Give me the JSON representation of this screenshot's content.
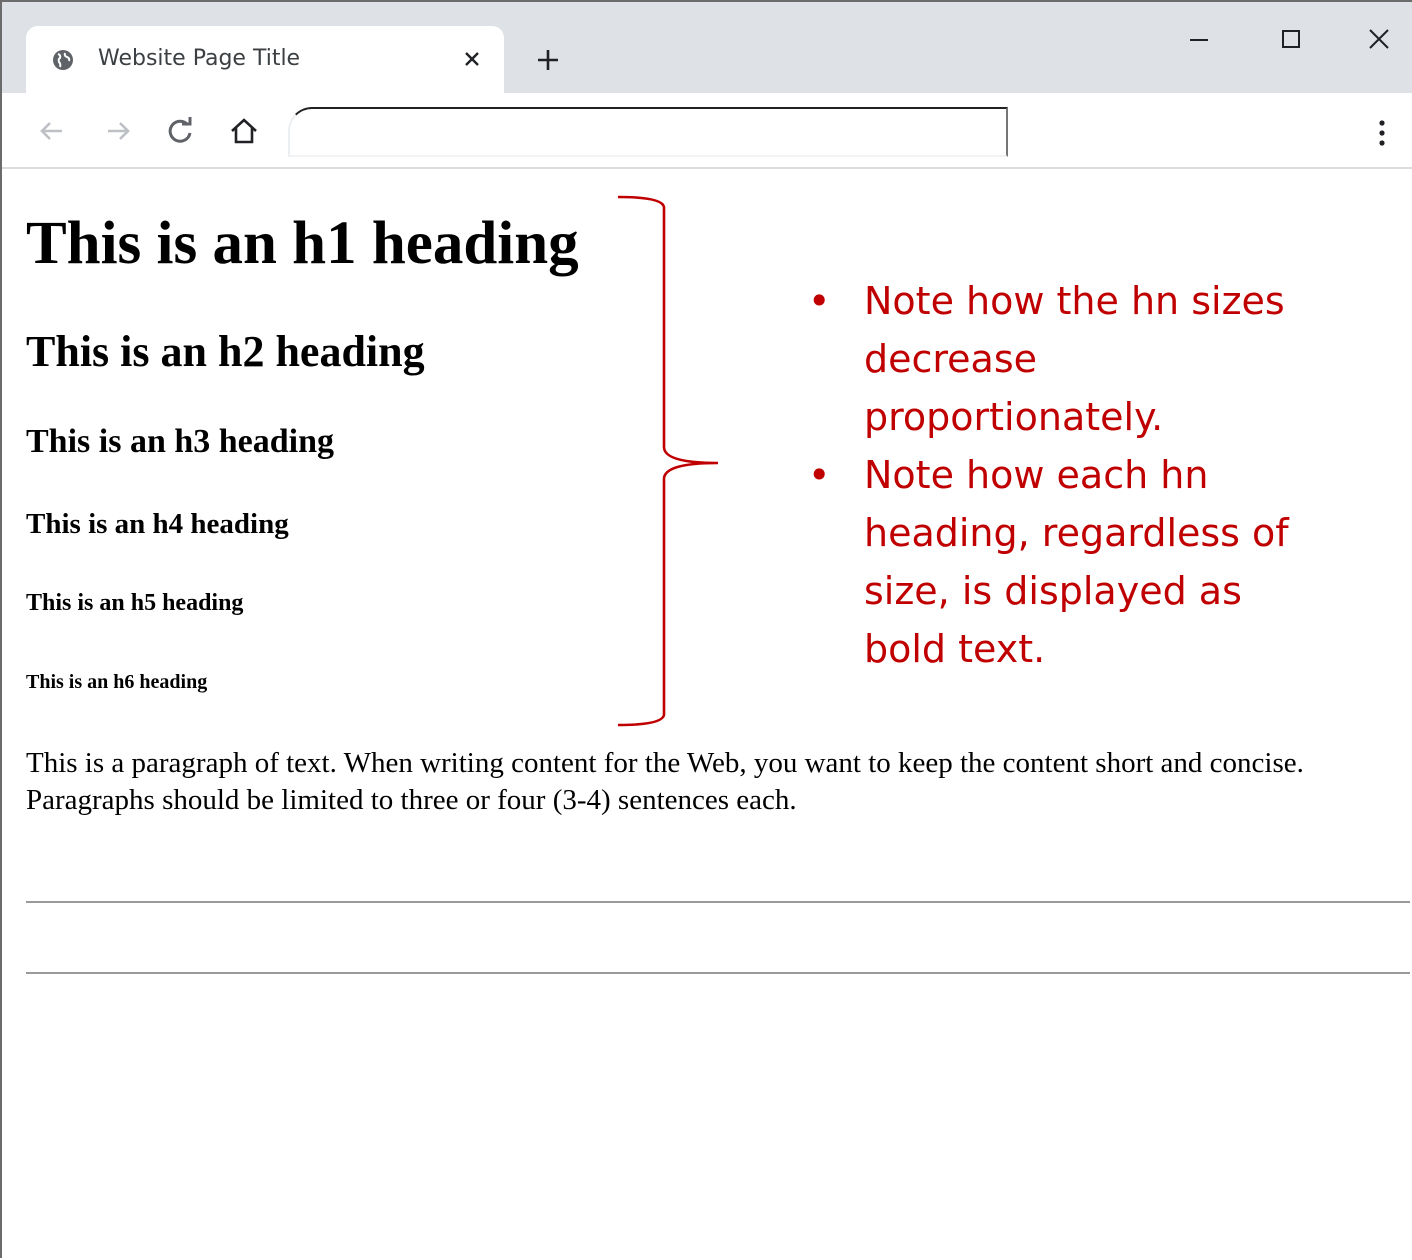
{
  "browser": {
    "tab_title": "Website Page Title",
    "address": "",
    "icons": {
      "favicon": "globe-icon",
      "tab_close": "close-icon",
      "new_tab": "plus-icon",
      "minimize": "minimize-icon",
      "maximize": "maximize-icon",
      "close": "close-icon",
      "back": "arrow-left-icon",
      "forward": "arrow-right-icon",
      "reload": "reload-icon",
      "home": "home-icon",
      "menu": "kebab-menu-icon"
    }
  },
  "page": {
    "headings": [
      "This is an h1 heading",
      "This is an h2 heading",
      "This is an h3 heading",
      "This is an h4 heading",
      "This is an h5 heading",
      "This is an h6 heading"
    ],
    "paragraph": "This is a paragraph of text. When writing content for the Web, you want to keep the content short and concise. Paragraphs should be limited to three or four (3-4) sentences each."
  },
  "annotation": {
    "bullet_char": "•",
    "notes": [
      "Note how the hn sizes decrease proportionately.",
      "Note how each hn heading, regardless of size, is displayed as bold text."
    ],
    "color": "#c00000"
  }
}
